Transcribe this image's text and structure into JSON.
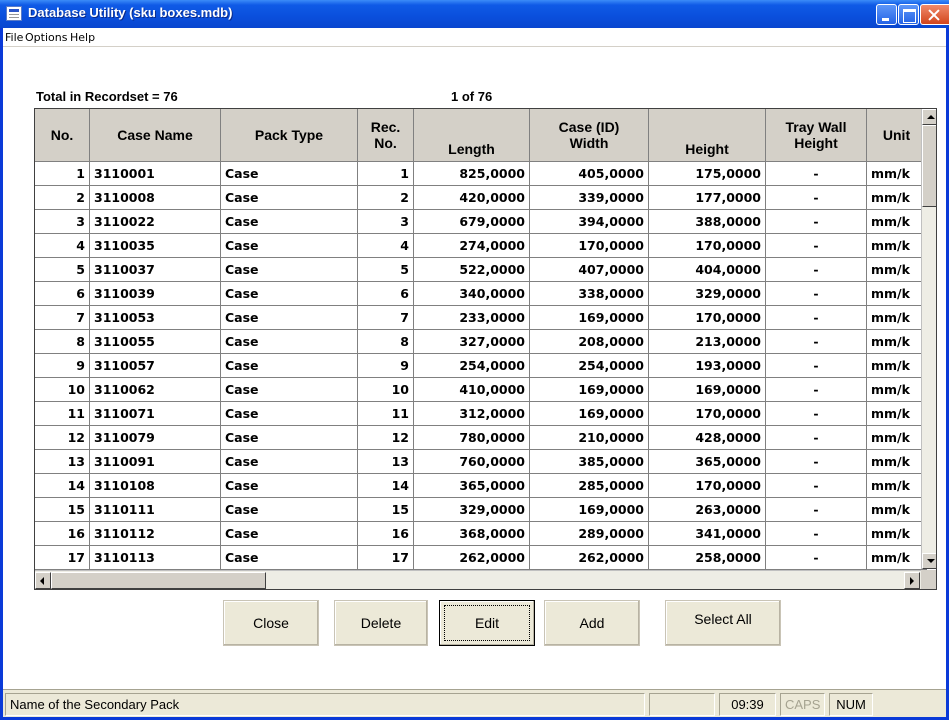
{
  "window": {
    "title": "Database Utility (sku boxes.mdb)"
  },
  "menu": [
    "File",
    "Options",
    "Help"
  ],
  "recordset": {
    "total_label": "Total in Recordset = 76",
    "position": "1 of 76"
  },
  "grid": {
    "columns": [
      "No.",
      "Case Name",
      "Pack Type",
      "Rec.\nNo.",
      "Length",
      "Case (ID)\nWidth",
      "Height",
      "Tray Wall\nHeight",
      "Unit"
    ],
    "rows": [
      [
        "1",
        "3110001",
        "Case",
        "1",
        "825,0000",
        "405,0000",
        "175,0000",
        "-",
        "mm/k"
      ],
      [
        "2",
        "3110008",
        "Case",
        "2",
        "420,0000",
        "339,0000",
        "177,0000",
        "-",
        "mm/k"
      ],
      [
        "3",
        "3110022",
        "Case",
        "3",
        "679,0000",
        "394,0000",
        "388,0000",
        "-",
        "mm/k"
      ],
      [
        "4",
        "3110035",
        "Case",
        "4",
        "274,0000",
        "170,0000",
        "170,0000",
        "-",
        "mm/k"
      ],
      [
        "5",
        "3110037",
        "Case",
        "5",
        "522,0000",
        "407,0000",
        "404,0000",
        "-",
        "mm/k"
      ],
      [
        "6",
        "3110039",
        "Case",
        "6",
        "340,0000",
        "338,0000",
        "329,0000",
        "-",
        "mm/k"
      ],
      [
        "7",
        "3110053",
        "Case",
        "7",
        "233,0000",
        "169,0000",
        "170,0000",
        "-",
        "mm/k"
      ],
      [
        "8",
        "3110055",
        "Case",
        "8",
        "327,0000",
        "208,0000",
        "213,0000",
        "-",
        "mm/k"
      ],
      [
        "9",
        "3110057",
        "Case",
        "9",
        "254,0000",
        "254,0000",
        "193,0000",
        "-",
        "mm/k"
      ],
      [
        "10",
        "3110062",
        "Case",
        "10",
        "410,0000",
        "169,0000",
        "169,0000",
        "-",
        "mm/k"
      ],
      [
        "11",
        "3110071",
        "Case",
        "11",
        "312,0000",
        "169,0000",
        "170,0000",
        "-",
        "mm/k"
      ],
      [
        "12",
        "3110079",
        "Case",
        "12",
        "780,0000",
        "210,0000",
        "428,0000",
        "-",
        "mm/k"
      ],
      [
        "13",
        "3110091",
        "Case",
        "13",
        "760,0000",
        "385,0000",
        "365,0000",
        "-",
        "mm/k"
      ],
      [
        "14",
        "3110108",
        "Case",
        "14",
        "365,0000",
        "285,0000",
        "170,0000",
        "-",
        "mm/k"
      ],
      [
        "15",
        "3110111",
        "Case",
        "15",
        "329,0000",
        "169,0000",
        "263,0000",
        "-",
        "mm/k"
      ],
      [
        "16",
        "3110112",
        "Case",
        "16",
        "368,0000",
        "289,0000",
        "341,0000",
        "-",
        "mm/k"
      ],
      [
        "17",
        "3110113",
        "Case",
        "17",
        "262,0000",
        "262,0000",
        "258,0000",
        "-",
        "mm/k"
      ]
    ]
  },
  "buttons": {
    "close": "Close",
    "delete": "Delete",
    "edit": "Edit",
    "add": "Add",
    "select_all": "Select All"
  },
  "statusbar": {
    "message": "Name of the Secondary Pack",
    "time": "09:39",
    "caps": "CAPS",
    "num": "NUM"
  },
  "icons": [
    "app-icon",
    "minimize-icon",
    "maximize-icon",
    "close-icon",
    "scroll-up-icon",
    "scroll-down-icon",
    "scroll-left-icon",
    "scroll-right-icon"
  ]
}
